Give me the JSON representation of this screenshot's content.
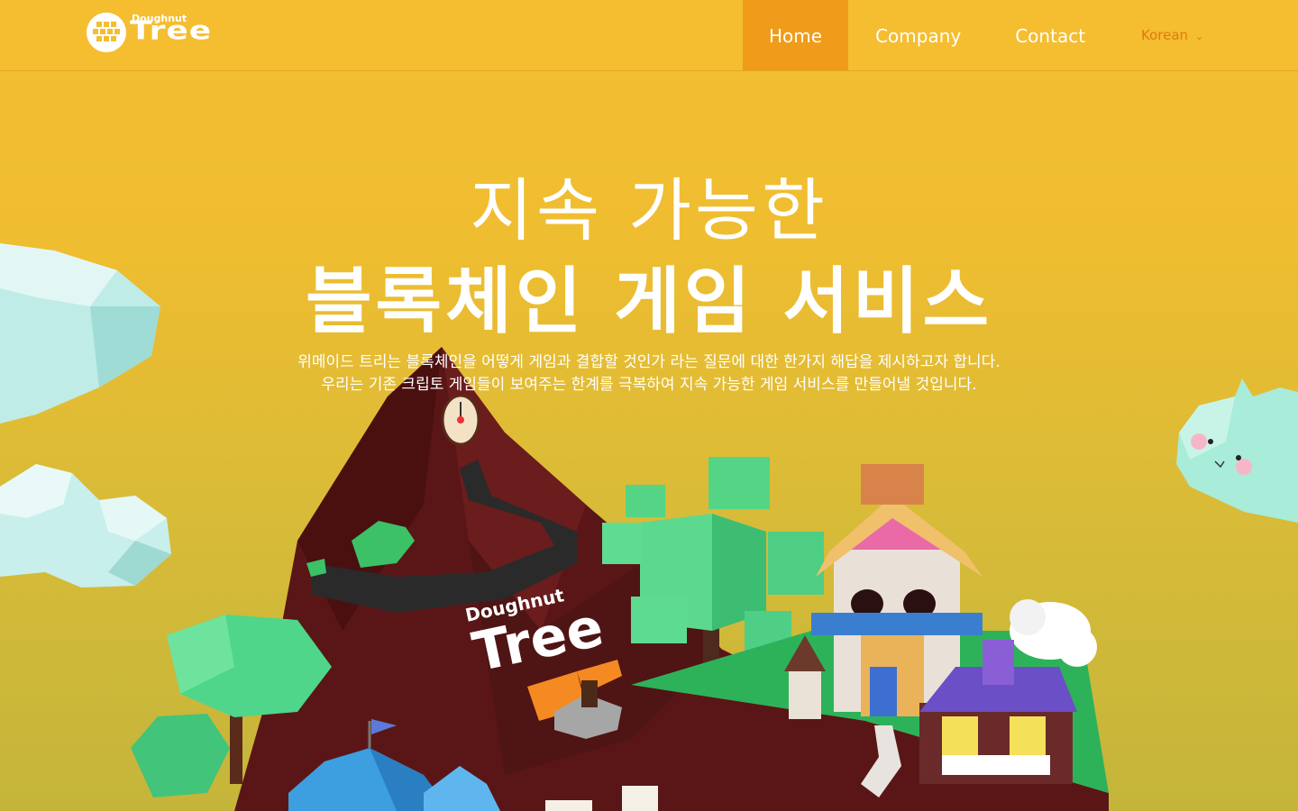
{
  "header": {
    "logo_small": "Doughnut",
    "logo_big": "Tree",
    "nav": [
      {
        "label": "Home",
        "active": true
      },
      {
        "label": "Company",
        "active": false
      },
      {
        "label": "Contact",
        "active": false
      }
    ],
    "language": "Korean"
  },
  "hero": {
    "title": "지속 가능한",
    "subtitle": "블록체인 게임 서비스",
    "desc_line1": "위메이드 트리는 블록체인을 어떻게 게임과 결합할 것인가 라는 질문에 대한 한가지 해답을 제시하고자 합니다.",
    "desc_line2": "우리는 기존 크립토 게임들이 보여주는 한계를 극복하여 지속 가능한 게임 서비스를 만들어낼 것입니다."
  },
  "illustration": {
    "sign_small": "Doughnut",
    "sign_big": "Tree"
  },
  "colors": {
    "header_bg": "#f5bd30",
    "active_nav": "#f09b1a",
    "language_text": "#e07a11"
  },
  "icons": [
    "logo-doughnut-icon",
    "chevron-down-icon"
  ]
}
